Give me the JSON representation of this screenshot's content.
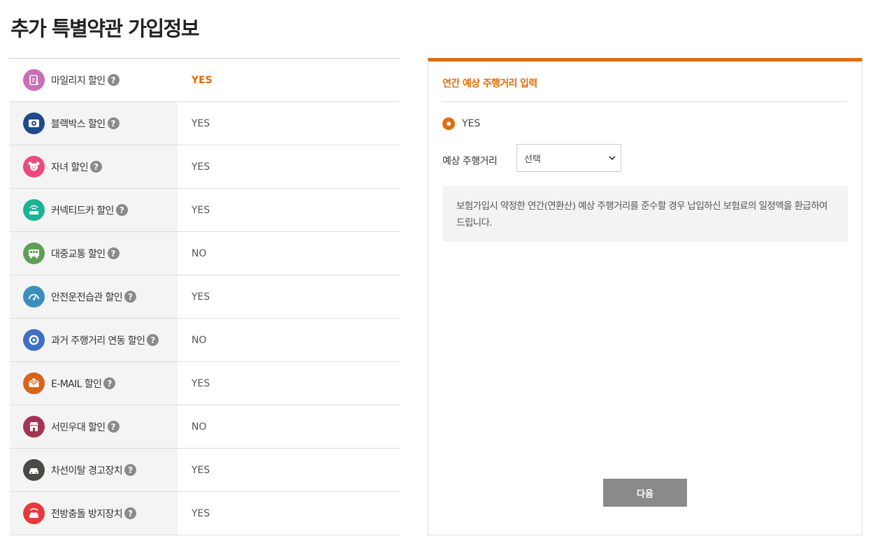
{
  "page_title": "추가 특별약관 가입정보",
  "help_glyph": "?",
  "discounts": [
    {
      "label": "마일리지 할인",
      "value": "YES",
      "icon": "mileage-icon",
      "color": "#c86fb6",
      "highlight": true
    },
    {
      "label": "블랙박스 할인",
      "value": "YES",
      "icon": "blackbox-icon",
      "color": "#1f4a8a"
    },
    {
      "label": "자녀 할인",
      "value": "YES",
      "icon": "child-icon",
      "color": "#ec4a7e"
    },
    {
      "label": "커넥티드카 할인",
      "value": "YES",
      "icon": "connected-car-icon",
      "color": "#1cb394"
    },
    {
      "label": "대중교통 할인",
      "value": "NO",
      "icon": "bus-icon",
      "color": "#5e9f55"
    },
    {
      "label": "안전운전습관 할인",
      "value": "YES",
      "icon": "speedometer-icon",
      "color": "#3a8fbf"
    },
    {
      "label": "과거 주행거리 연동 할인",
      "value": "NO",
      "icon": "target-icon",
      "color": "#3e6fc4"
    },
    {
      "label": "E-MAIL 할인",
      "value": "YES",
      "icon": "email-icon",
      "color": "#d8641c"
    },
    {
      "label": "서민우대 할인",
      "value": "NO",
      "icon": "store-icon",
      "color": "#a53352"
    },
    {
      "label": "차선이탈 경고장치",
      "value": "YES",
      "icon": "lane-car-icon",
      "color": "#4a4a44"
    },
    {
      "label": "전방충돌 방지장치",
      "value": "YES",
      "icon": "collision-car-icon",
      "color": "#e63a3a"
    }
  ],
  "panel": {
    "title": "연간 예상 주행거리 입력",
    "radio_label": "YES",
    "distance_label": "예상 주행거리",
    "select_value": "선택",
    "info_text": "보험가입시 약정한 연간(연환산) 예상 주행거리를 준수할 경우 납입하신 보험료의 일정액을 환급하여 드립니다.",
    "next_label": "다음"
  },
  "colors": {
    "accent": "#e36c0a",
    "button": "#8a8a8a"
  }
}
